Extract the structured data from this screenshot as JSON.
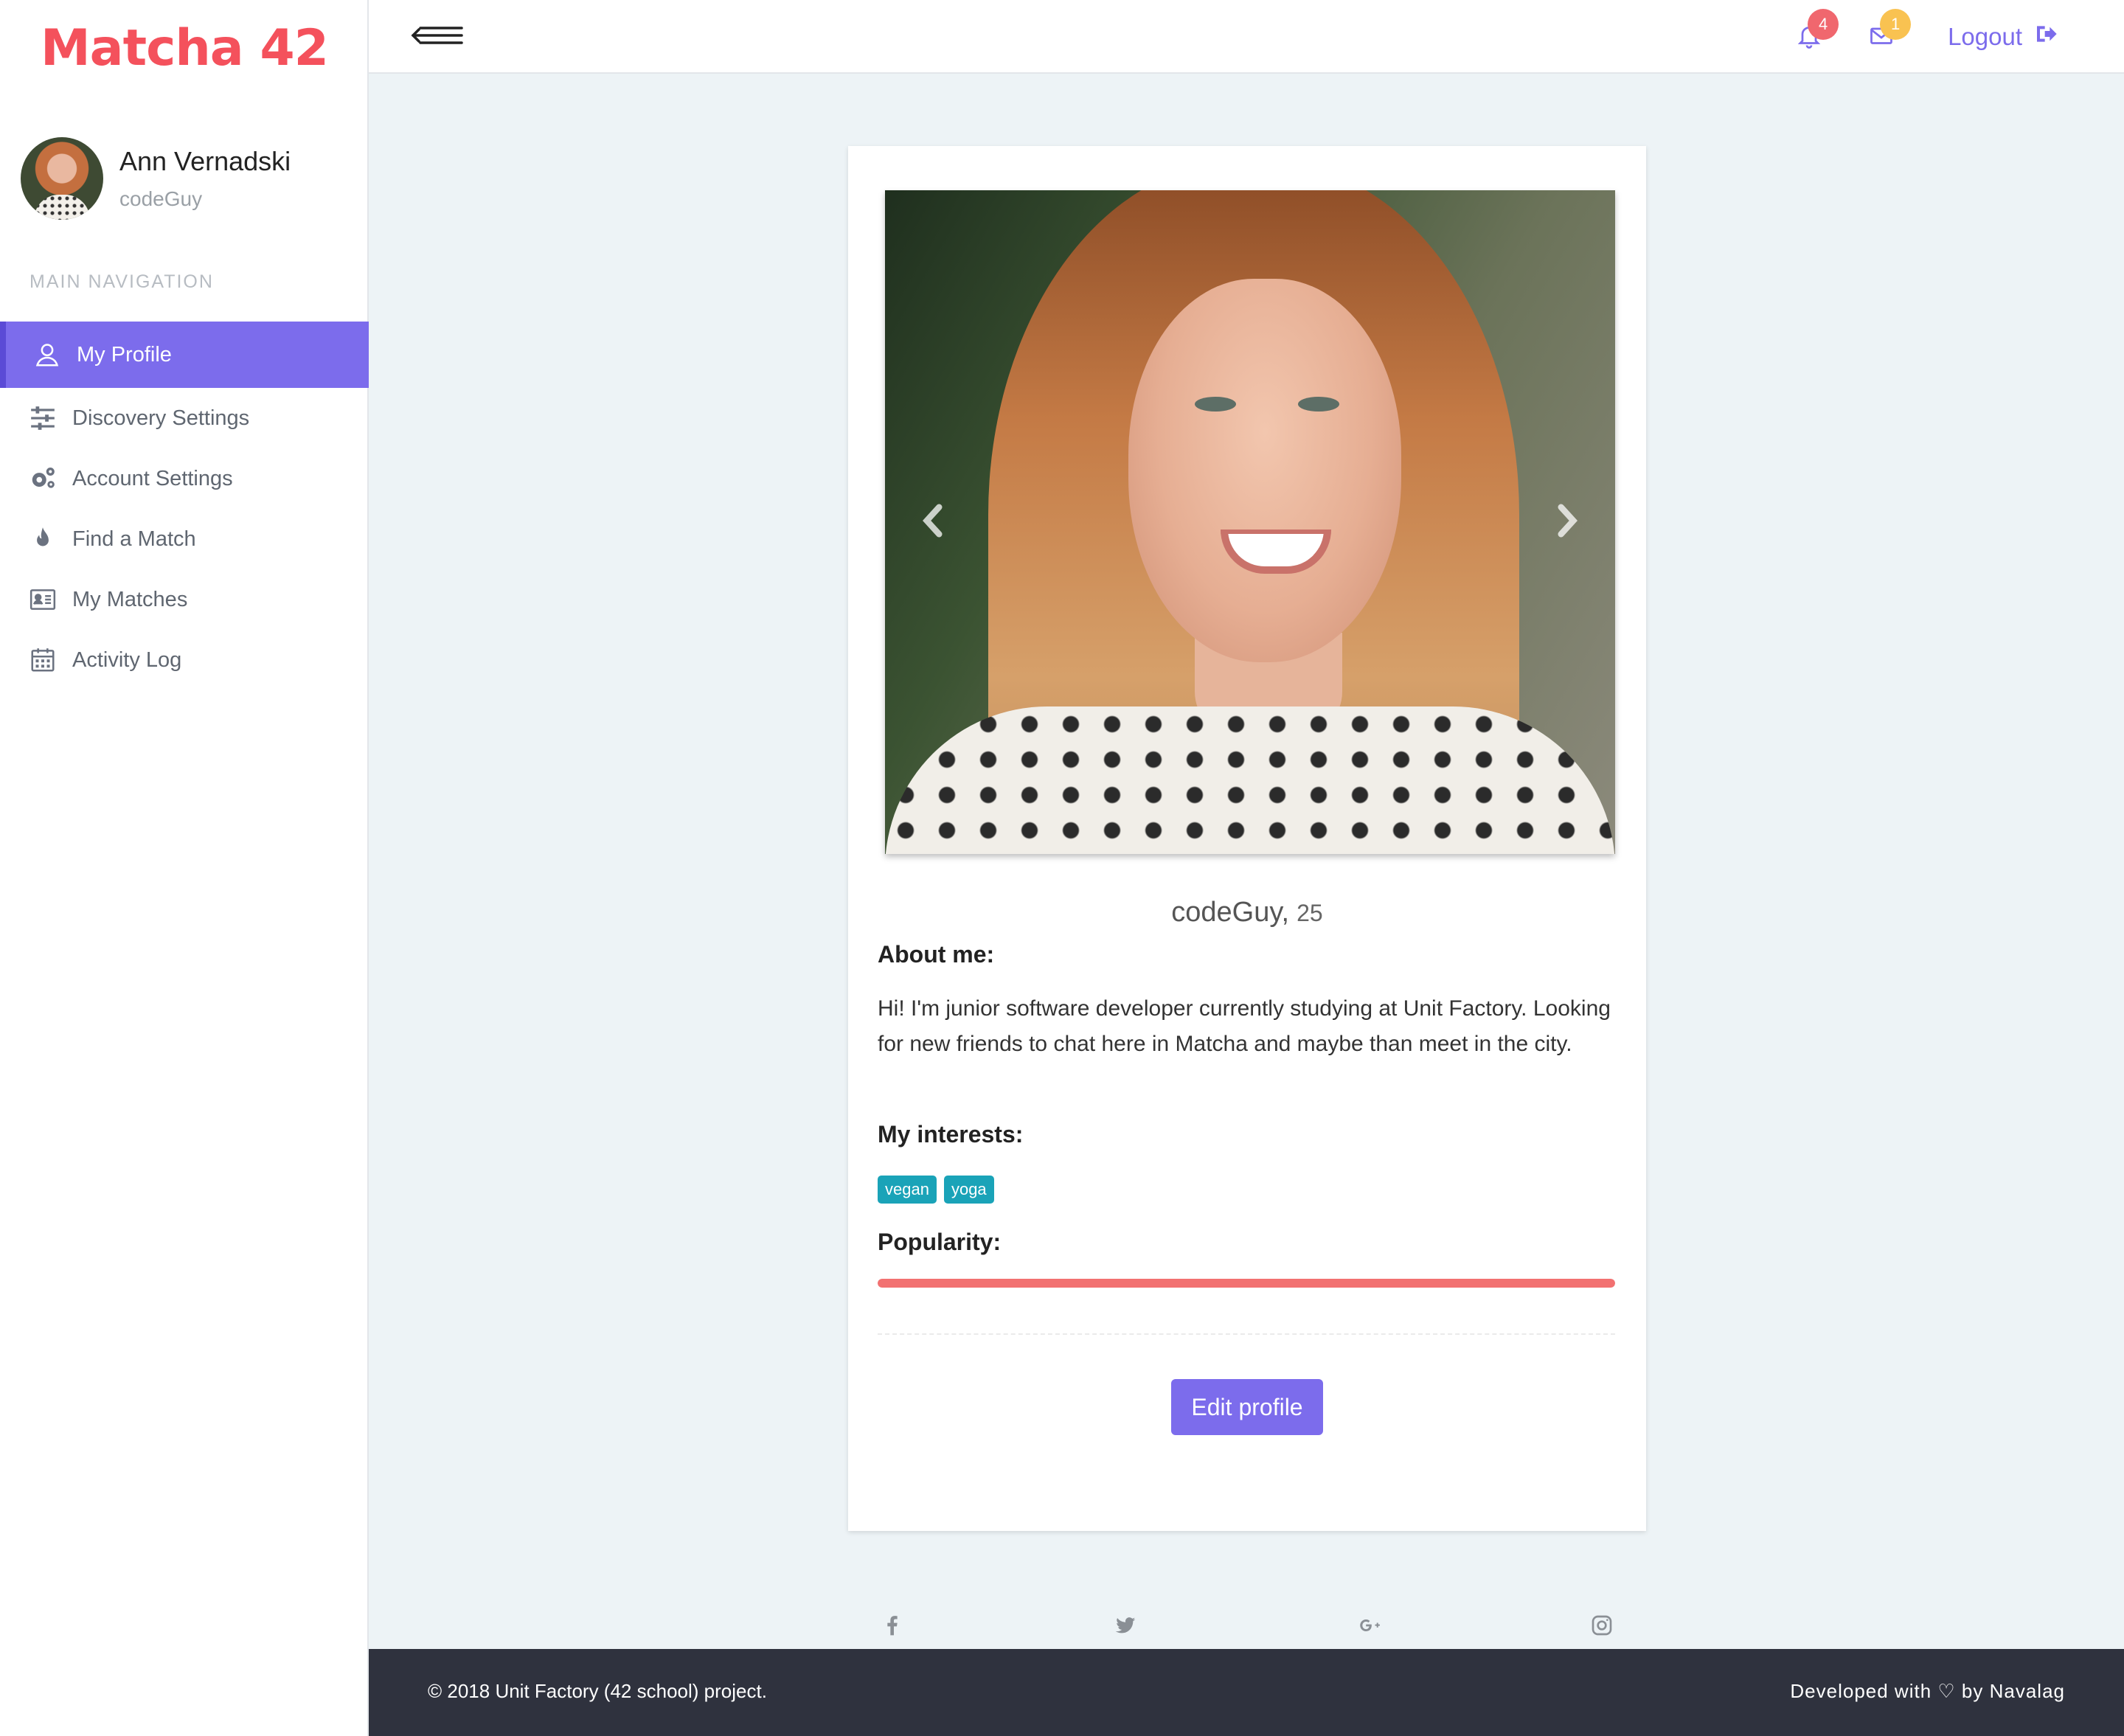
{
  "app": {
    "brand": "Matcha 42"
  },
  "user": {
    "full_name": "Ann Vernadski",
    "login": "codeGuy"
  },
  "sidebar": {
    "header": "MAIN NAVIGATION",
    "items": [
      {
        "label": "My Profile",
        "icon": "user-icon",
        "active": true
      },
      {
        "label": "Discovery Settings",
        "icon": "sliders-icon"
      },
      {
        "label": "Account Settings",
        "icon": "gears-icon"
      },
      {
        "label": "Find a Match",
        "icon": "fire-icon"
      },
      {
        "label": "My Matches",
        "icon": "id-card-icon"
      },
      {
        "label": "Activity Log",
        "icon": "calendar-icon"
      }
    ]
  },
  "topbar": {
    "notifications_count": "4",
    "messages_count": "1",
    "logout_label": "Logout"
  },
  "profile": {
    "name": "codeGuy,",
    "age": "25",
    "about_title": "About me:",
    "about_text": "Hi! I'm junior software developer currently studying at Unit Factory. Looking for new friends to chat here in Matcha and maybe than meet in the city.",
    "interests_title": "My interests:",
    "interests": [
      "vegan",
      "yoga"
    ],
    "popularity_title": "Popularity:",
    "popularity_percent": 100,
    "edit_label": "Edit profile"
  },
  "social": [
    "facebook-icon",
    "twitter-icon",
    "google-plus-icon",
    "instagram-icon"
  ],
  "colors": {
    "accent": "#7c6cec",
    "brand": "#f4515c",
    "tag": "#1aa3b8",
    "popularity": "#f27171",
    "footer": "#2f323e"
  },
  "footer": {
    "left": "© 2018 Unit Factory (42 school) project.",
    "right": "Developed with ♡ by Navalag"
  }
}
